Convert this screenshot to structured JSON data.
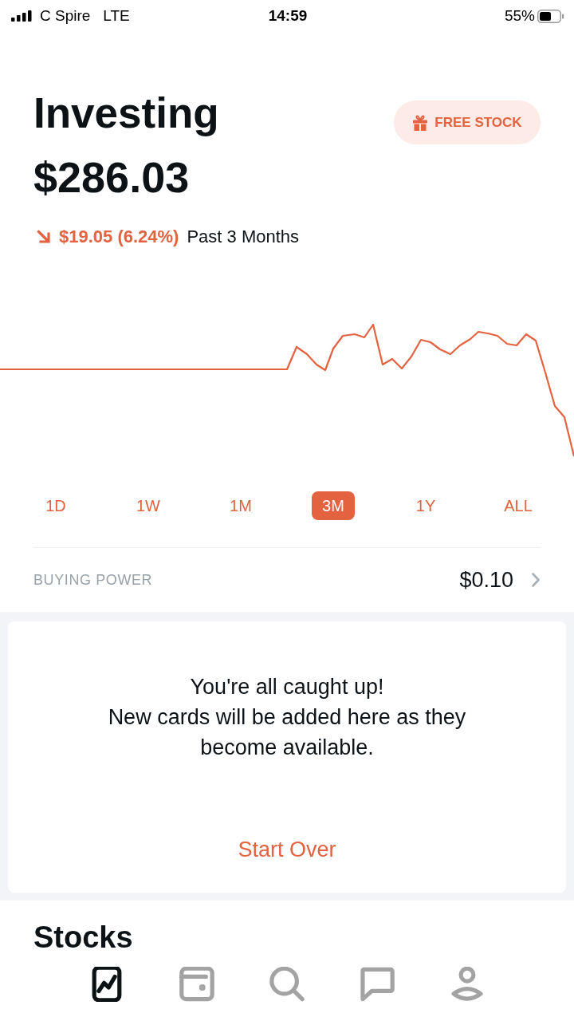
{
  "status_bar": {
    "carrier": "C Spire",
    "network": "LTE",
    "time": "14:59",
    "battery": "55%"
  },
  "header": {
    "title": "Investing",
    "balance": "$286.03",
    "promo_button": "FREE STOCK"
  },
  "change": {
    "negative": true,
    "amount": "$19.05 (6.24%)",
    "period": "Past 3 Months"
  },
  "ranges": [
    {
      "label": "1D",
      "selected": false
    },
    {
      "label": "1W",
      "selected": false
    },
    {
      "label": "1M",
      "selected": false
    },
    {
      "label": "3M",
      "selected": true
    },
    {
      "label": "1Y",
      "selected": false
    },
    {
      "label": "ALL",
      "selected": false
    }
  ],
  "buying_power": {
    "label": "BUYING POWER",
    "value": "$0.10"
  },
  "feed_card": {
    "message": "You're all caught up!\nNew cards will be added here as they become available.",
    "action": "Start Over"
  },
  "section_title": "Stocks",
  "tab_bar": [
    {
      "kind": "portfolio",
      "selected": true
    },
    {
      "kind": "wallet",
      "selected": false
    },
    {
      "kind": "search",
      "selected": false
    },
    {
      "kind": "messages",
      "selected": false
    },
    {
      "kind": "account",
      "selected": false
    }
  ]
}
